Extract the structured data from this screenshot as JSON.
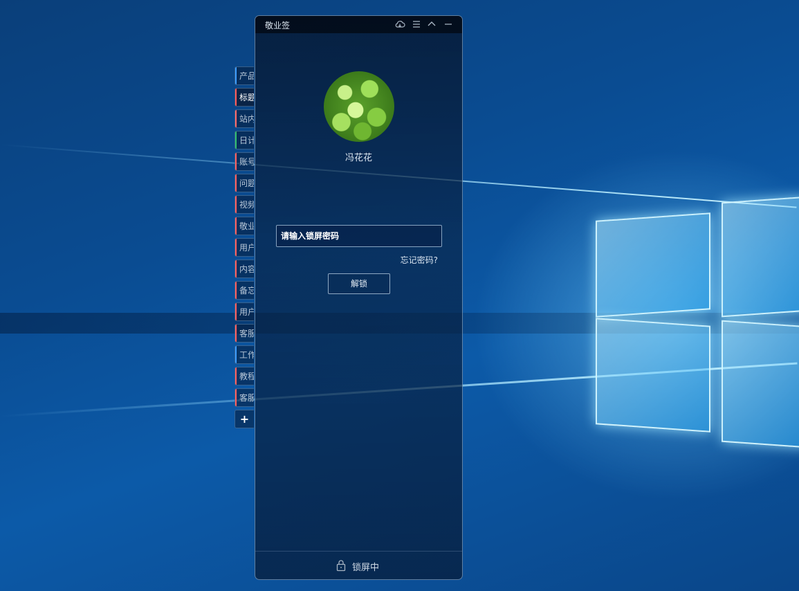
{
  "window": {
    "title": "敬业签",
    "titlebar_icons": [
      "cloud-sync-icon",
      "menu-icon",
      "collapse-icon",
      "minimize-icon"
    ]
  },
  "side_tabs": [
    {
      "label": "产品",
      "color": "#3a9cff",
      "active": false
    },
    {
      "label": "标题",
      "color": "#ff5a5a",
      "active": true
    },
    {
      "label": "站内",
      "color": "#ff6a6a",
      "active": false
    },
    {
      "label": "日计",
      "color": "#30c070",
      "active": false
    },
    {
      "label": "账号",
      "color": "#ff6060",
      "active": false
    },
    {
      "label": "问题",
      "color": "#ff6060",
      "active": false
    },
    {
      "label": "视频",
      "color": "#ff6060",
      "active": false
    },
    {
      "label": "敬业",
      "color": "#ff6060",
      "active": false
    },
    {
      "label": "用户",
      "color": "#ff6060",
      "active": false
    },
    {
      "label": "内容",
      "color": "#ff6060",
      "active": false
    },
    {
      "label": "备忘",
      "color": "#ff6060",
      "active": false
    },
    {
      "label": "用户",
      "color": "#ff6060",
      "active": false
    },
    {
      "label": "客服",
      "color": "#ff6060",
      "active": false
    },
    {
      "label": "工作",
      "color": "#3a9cff",
      "active": false
    },
    {
      "label": "教程",
      "color": "#ff6060",
      "active": false
    },
    {
      "label": "客服",
      "color": "#ff6060",
      "active": false
    }
  ],
  "add_tab_label": "+",
  "lock_screen": {
    "username": "冯花花",
    "password_placeholder": "请输入锁屏密码",
    "password_value": "",
    "forgot_label": "忘记密码?",
    "unlock_label": "解锁"
  },
  "status": {
    "text": "锁屏中",
    "icon": "lock-icon"
  }
}
